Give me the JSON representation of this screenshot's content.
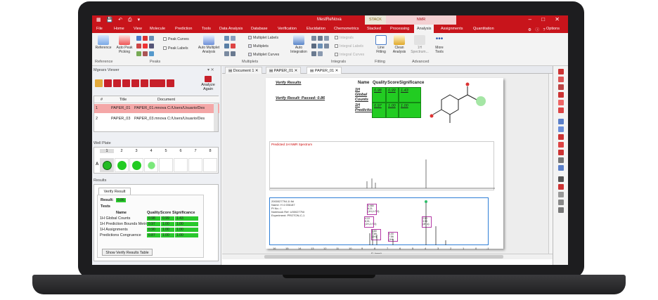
{
  "app": {
    "title": "MestReNova",
    "qat_icons": [
      "app-icon",
      "save-icon",
      "undo-icon",
      "print-icon",
      "dropdown-icon"
    ],
    "context_tabs": {
      "stack_group": "STACK",
      "nmr_group": "NMR"
    },
    "window_controls": {
      "minimize": "–",
      "maximize": "□",
      "close": "✕"
    }
  },
  "menu": {
    "items": [
      "File",
      "Home",
      "View",
      "Molecule",
      "Prediction",
      "Tools",
      "Data Analysis",
      "Database",
      "Verification",
      "Elucidation",
      "Chemometrics",
      "Stacked",
      "Processing",
      "Analysis",
      "Assignments",
      "Quantitation"
    ],
    "selected": "Analysis",
    "options_label": "Options"
  },
  "ribbon": {
    "buttons": {
      "reference": "Reference",
      "auto_peak": "Auto Peak Picking",
      "auto_multiplet": "Auto Multiplet Analysis",
      "auto_integration": "Auto Integration",
      "line_fitting": "Line Fitting",
      "clean_analysis": "Clean Analysis",
      "h_spectrum": "1H Spectrum...",
      "more_tools": "More Tools"
    },
    "checks": {
      "peak_curves": "Peak Curves",
      "peak_labels": "Peak Labels",
      "multiplet_labels": "Multiplet Labels",
      "multiplets": "Multiplets",
      "multiplet_curves": "Multiplet Curves",
      "integrals": "Integrals",
      "integral_labels": "Integral Labels",
      "integral_curves": "Integral Curves"
    },
    "groups": [
      "Reference",
      "Peaks",
      "Multiplets",
      "Integrals",
      "Fitting",
      "Advanced"
    ]
  },
  "left_panel": {
    "title": "Mgears Viewer",
    "analyze_again": "Analyze Again",
    "table": {
      "headers": [
        "#",
        "Title",
        "Document"
      ],
      "rows": [
        [
          "1",
          "PAPER_01",
          "PAPER_01.mnova  C:/Users/Usuario/Des"
        ],
        [
          "2",
          "PAPER_03",
          "PAPER_03.mnova  C:/Users/Usuario/Des"
        ]
      ]
    },
    "well_plate": {
      "title": "Well Plate",
      "columns": [
        "1",
        "2",
        "3",
        "4",
        "5",
        "6",
        "7",
        "8"
      ],
      "row_label": "A",
      "wells": [
        "#22bb22",
        "#22cc22",
        "#22cc22",
        "#7be87b",
        "",
        "",
        "",
        ""
      ]
    },
    "results": {
      "title": "Results",
      "tab": "Verify Result",
      "result_label": "Result:",
      "result_value": "0.86",
      "tests_label": "Tests",
      "headers": {
        "name": "Name",
        "quality": "Quality",
        "score": "Score",
        "significance": "Significance"
      },
      "tests": [
        {
          "name": "1H Global Counts",
          "quality": "0.98",
          "score": "0.99",
          "significance": "1.43"
        },
        {
          "name": "1H Prediction Bounds Metric",
          "quality": "0.97",
          "score": "1.00",
          "significance": "1.00"
        },
        {
          "name": "1H Assignments",
          "quality": "0.90",
          "score": "1.00",
          "significance": "1.00"
        },
        {
          "name": "Predictions Congruence",
          "quality": "0.87",
          "score": "1.00",
          "significance": "1.00"
        }
      ],
      "show_table_button": "Show Verify Results Table"
    }
  },
  "documents": {
    "tabs": [
      "Document 1",
      "PAPER_01",
      "PAPER_01"
    ],
    "active_index": 2
  },
  "page": {
    "verify_results_heading": "Verify Results",
    "verify_result_passed": "Verify Result: Passed: 0.86",
    "table_headers": {
      "name": "Name",
      "quality": "Quality",
      "score": "Score",
      "significance": "Significance"
    },
    "rows": [
      {
        "name": "1H Global Counts",
        "quality": "0.98",
        "score": "0.99",
        "significance": "1.43"
      },
      {
        "name": "1H Prediction",
        "quality": "0.97",
        "score": "1.00",
        "significance": "1.00"
      }
    ],
    "predicted_label": "Predicted 1H NMR Spectrum",
    "sample_info": [
      "20000277NI-1I.fid",
      "Name: H 4 006187",
      "Pi No.: I",
      "Notebook Ref: U000277NI",
      "Experiment: PROTON-C-1"
    ],
    "multiplet_labels": [
      "5.080\n8.21\n(1H,J=7.0)",
      "4.10\n8.01\n(1H,J=7.0)",
      "3.80\n7.89\n(1H)",
      "6.00\n7.56\n(1H)",
      "2.50\n3.95\n(3H,s)"
    ],
    "axis_ticks": [
      "16",
      "15",
      "14",
      "13",
      "12",
      "11",
      "10",
      "9",
      "8",
      "7",
      "6",
      "5",
      "4",
      "3",
      "2",
      "1",
      "0",
      "-1"
    ],
    "axis_unit": "f1 (ppm)"
  },
  "colors": {
    "brand_red": "#c8141b",
    "pass_green": "#22cc22"
  }
}
